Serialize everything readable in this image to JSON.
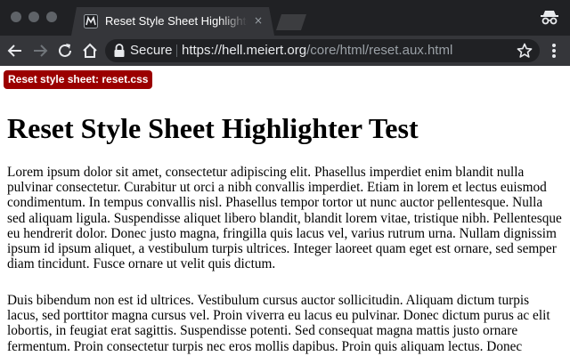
{
  "browser": {
    "tab": {
      "title": "Reset Style Sheet Highlighter Test",
      "close_glyph": "×"
    },
    "omnibox": {
      "security_label": "Secure",
      "url_host": "https://hell.meiert.org",
      "url_path": "/core/html/reset.aux.html"
    },
    "icons": {
      "favicon": "meiert-favicon",
      "incognito": "incognito-icon",
      "back": "back-arrow-icon",
      "forward": "forward-arrow-icon",
      "reload": "reload-icon",
      "home": "home-icon",
      "lock": "lock-icon",
      "bookmark": "star-icon",
      "menu": "kebab-menu-icon"
    },
    "colors": {
      "chrome_dark": "#202124",
      "chrome_tab": "#35363a",
      "badge_bg": "#9b0000"
    }
  },
  "page": {
    "badge": "Reset style sheet: reset.css",
    "title": "Reset Style Sheet Highlighter Test",
    "paragraphs": [
      "Lorem ipsum dolor sit amet, consectetur adipiscing elit. Phasellus imperdiet enim blandit nulla pulvinar consectetur. Curabitur ut orci a nibh convallis imperdiet. Etiam in lorem et lectus euismod condimentum. In tempus convallis nisl. Phasellus tempor tortor ut nunc auctor pellentesque. Nulla sed aliquam ligula. Suspendisse aliquet libero blandit, blandit lorem vitae, tristique nibh. Pellentesque eu hendrerit dolor. Donec justo magna, fringilla quis lacus vel, varius rutrum urna. Nullam dignissim ipsum id ipsum aliquet, a vestibulum turpis ultrices. Integer laoreet quam eget est ornare, sed semper diam tincidunt. Fusce ornare ut velit quis dictum.",
      "Duis bibendum non est id ultrices. Vestibulum cursus auctor sollicitudin. Aliquam dictum turpis lacus, sed porttitor magna cursus vel. Proin viverra eu lacus eu pulvinar. Donec dictum purus ac elit lobortis, in feugiat erat sagittis. Suspendisse potenti. Sed consequat magna mattis justo ornare fermentum. Proin consectetur turpis nec eros mollis dapibus. Proin quis aliquam lectus. Donec"
    ]
  }
}
